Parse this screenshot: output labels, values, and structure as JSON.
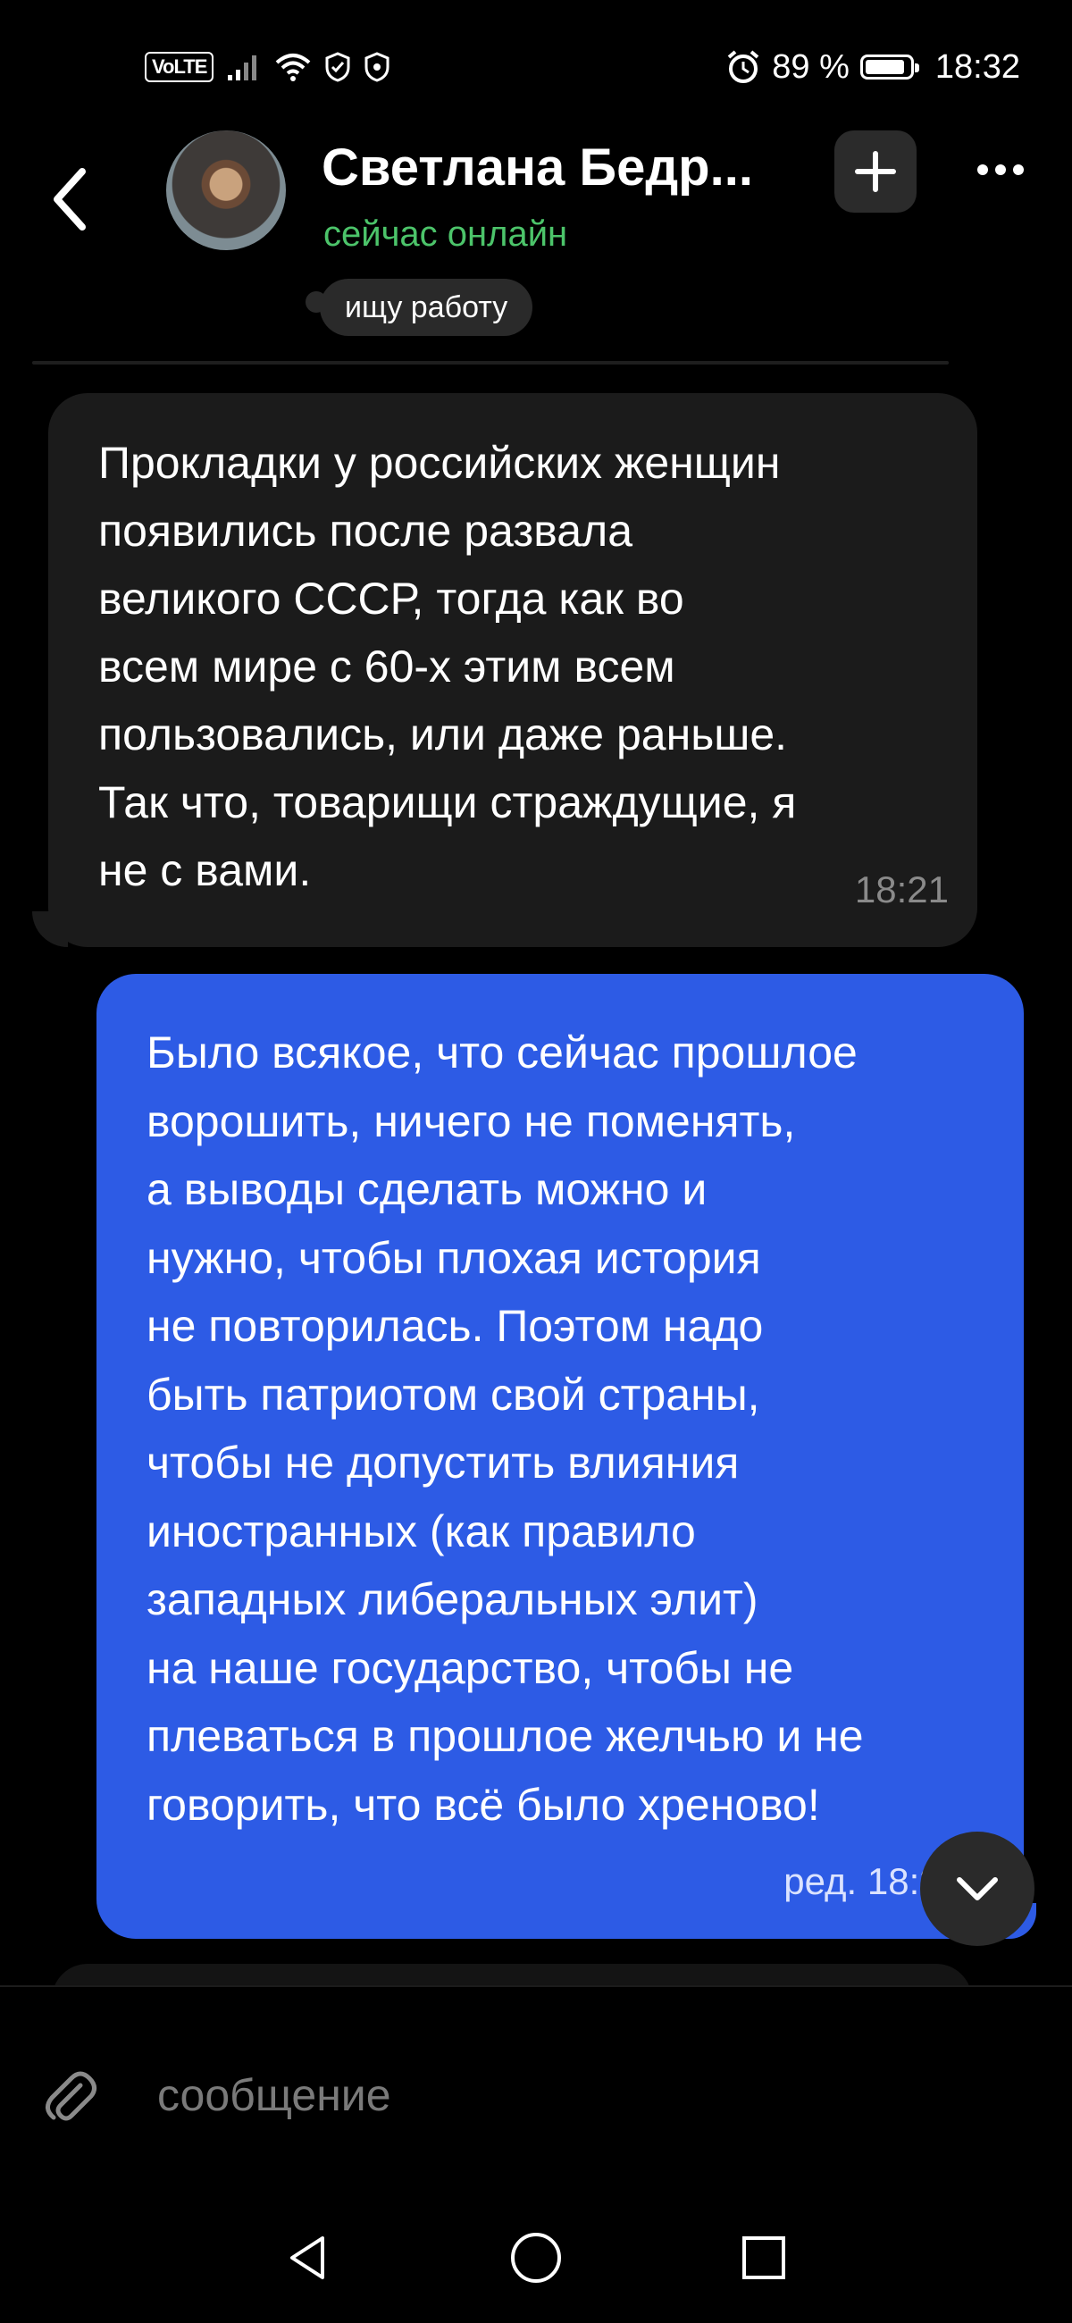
{
  "status_bar": {
    "volte": "VoLTE",
    "battery_percent": "89 %",
    "battery_level": 0.89,
    "time": "18:32",
    "icons": [
      "signal-icon",
      "wifi-icon",
      "shield-icon",
      "shield-icon",
      "alarm-icon",
      "battery-icon"
    ]
  },
  "header": {
    "contact_name": "Светлана Бедр...",
    "presence": "сейчас онлайн",
    "status_chip": "ищу работу",
    "presence_color": "#4cc46a"
  },
  "messages": [
    {
      "direction": "incoming",
      "text": "Прокладки у российских женщин\nпоявились после развала\nвеликого СССР, тогда как во\nвсем мире с 60-х этим всем\nпользовались, или даже раньше.\nТак что, товарищи страждущие, я\nне с вами.",
      "time": "18:21"
    },
    {
      "direction": "outgoing",
      "text": "Было всякое, что сейчас прошлое\nворошить, ничего не поменять,\nа выводы сделать можно и\nнужно, чтобы плохая история\nне повторилась. Поэтом надо\nбыть патриотом свой страны,\nчтобы не допустить влияния\nиностранных (как правило\nзападных либеральных элит)\nна наше государство, чтобы не\nплеваться в прошлое желчью и не\nговорить, что всё было хреново!",
      "time": "ред. 18:25",
      "bubble_color": "#2d5be5"
    }
  ],
  "composer": {
    "placeholder": "сообщение"
  }
}
